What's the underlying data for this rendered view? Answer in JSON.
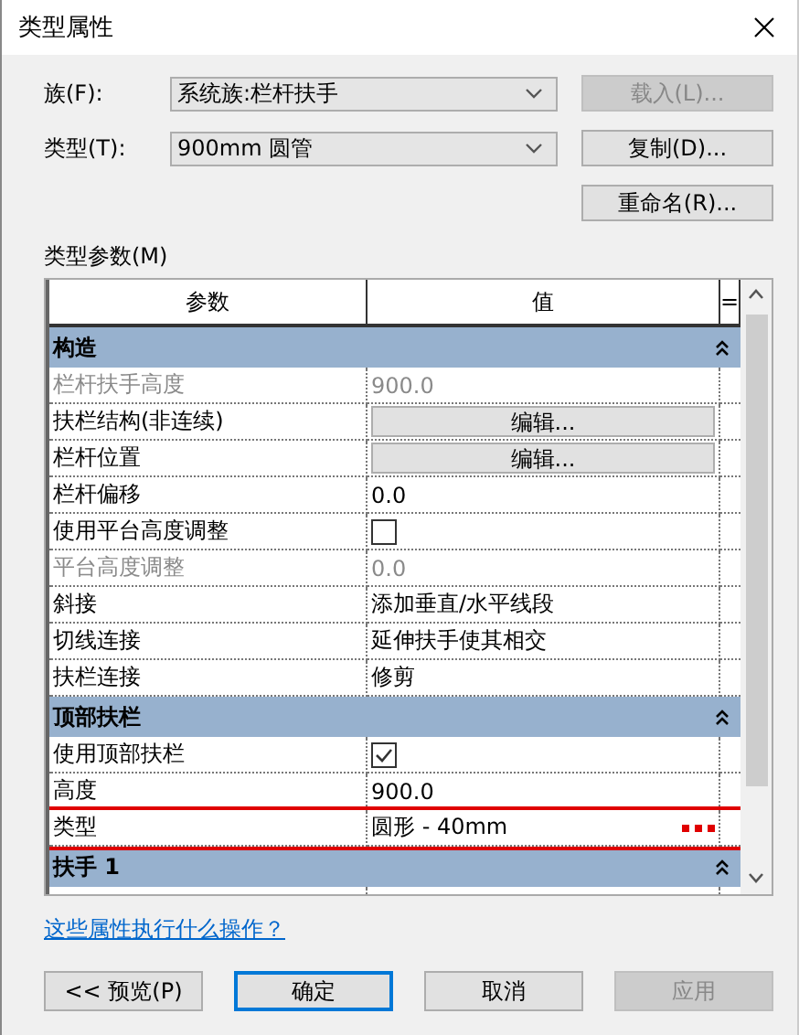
{
  "window": {
    "title": "类型属性"
  },
  "family": {
    "label": "族(F):",
    "value": "系统族:栏杆扶手"
  },
  "type": {
    "label": "类型(T):",
    "value": "900mm 圆管"
  },
  "side_buttons": [
    {
      "label": "载入(L)...",
      "disabled": true
    },
    {
      "label": "复制(D)...",
      "disabled": false
    },
    {
      "label": "重命名(R)...",
      "disabled": false
    }
  ],
  "grid": {
    "label": "类型参数(M)",
    "columns": [
      "参数",
      "值",
      "="
    ],
    "rows": [
      {
        "kind": "section",
        "name": "构造",
        "expanded": true
      },
      {
        "kind": "text",
        "name": "栏杆扶手高度",
        "value": "900.0",
        "disabled": true,
        "highlighted": false
      },
      {
        "kind": "button",
        "name": "扶栏结构(非连续)",
        "value": "编辑...",
        "disabled": false,
        "highlighted": false
      },
      {
        "kind": "button",
        "name": "栏杆位置",
        "value": "编辑...",
        "disabled": false,
        "highlighted": false
      },
      {
        "kind": "text",
        "name": "栏杆偏移",
        "value": "0.0",
        "disabled": false,
        "highlighted": false
      },
      {
        "kind": "checkbox",
        "name": "使用平台高度调整",
        "checked": false,
        "disabled": false,
        "highlighted": false
      },
      {
        "kind": "text",
        "name": "平台高度调整",
        "value": "0.0",
        "disabled": true,
        "highlighted": false
      },
      {
        "kind": "text",
        "name": "斜接",
        "value": "添加垂直/水平线段",
        "disabled": false,
        "highlighted": false
      },
      {
        "kind": "text",
        "name": "切线连接",
        "value": "延伸扶手使其相交",
        "disabled": false,
        "highlighted": false
      },
      {
        "kind": "text",
        "name": "扶栏连接",
        "value": "修剪",
        "disabled": false,
        "highlighted": false
      },
      {
        "kind": "section",
        "name": "顶部扶栏",
        "expanded": true
      },
      {
        "kind": "checkbox",
        "name": "使用顶部扶栏",
        "checked": true,
        "disabled": false,
        "highlighted": false
      },
      {
        "kind": "text",
        "name": "高度",
        "value": "900.0",
        "disabled": false,
        "highlighted": false
      },
      {
        "kind": "browse",
        "name": "类型",
        "value": "圆形 - 40mm",
        "disabled": false,
        "highlighted": true
      },
      {
        "kind": "section",
        "name": "扶手 1",
        "expanded": true
      },
      {
        "kind": "partial"
      }
    ]
  },
  "help_link": "这些属性执行什么操作？",
  "buttons": [
    {
      "label": "<< 预览(P)",
      "default": false,
      "disabled": false
    },
    {
      "label": "确定",
      "default": true,
      "disabled": false
    },
    {
      "label": "取消",
      "default": false,
      "disabled": false
    },
    {
      "label": "应用",
      "default": false,
      "disabled": true
    }
  ]
}
